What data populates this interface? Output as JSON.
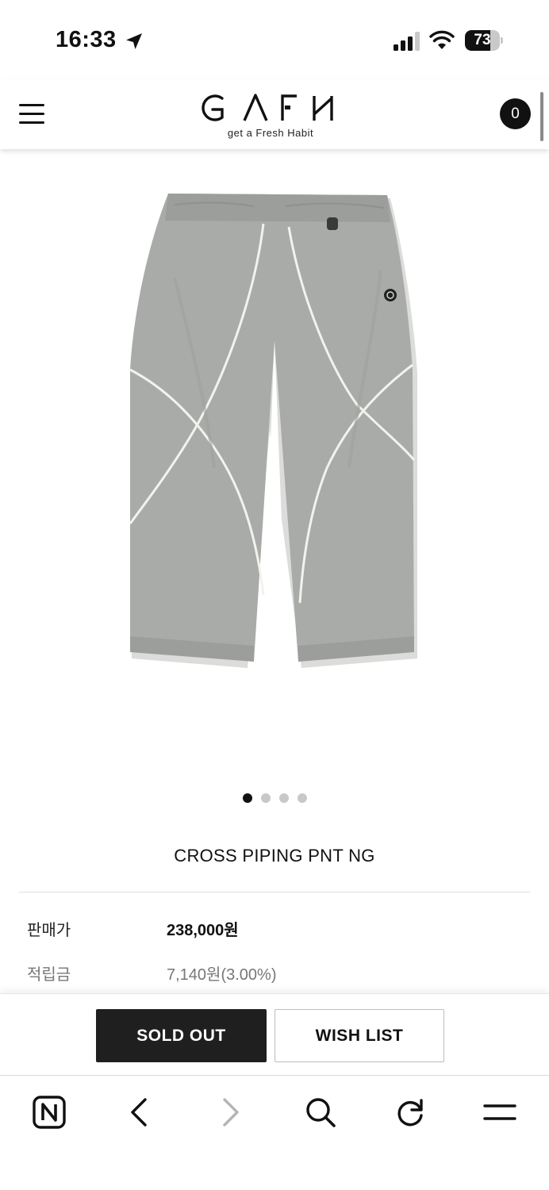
{
  "status_bar": {
    "time": "16:33",
    "battery_level": "73",
    "battery_fraction": 0.73,
    "icons": [
      "location-arrow-icon",
      "cellular-signal-icon",
      "wifi-icon",
      "battery-icon"
    ]
  },
  "header": {
    "logo_mark": "GAFH",
    "logo_tagline": "get a Fresh Habit",
    "cart_count": "0",
    "menu_icon": "hamburger-menu-icon"
  },
  "product": {
    "image_alt": "gray nylon pants with white cross piping",
    "image_count": 4,
    "active_image_index": 0,
    "name": "CROSS PIPING PNT NG",
    "price_label": "판매가",
    "price_value": "238,000원",
    "points_label": "적립금",
    "points_value": "7,140원(3.00%)"
  },
  "actions": {
    "sold_out_label": "SOLD OUT",
    "wish_list_label": "WISH LIST"
  },
  "browser_toolbar": {
    "items": [
      "naver-home-icon",
      "back-icon",
      "forward-icon",
      "search-icon",
      "reload-icon",
      "menu-icon"
    ]
  },
  "colors": {
    "primary_dark": "#1f1f1f",
    "pants_gray": "#a9aba8",
    "piping_white": "#f2f2ee",
    "muted_text": "#777777"
  }
}
